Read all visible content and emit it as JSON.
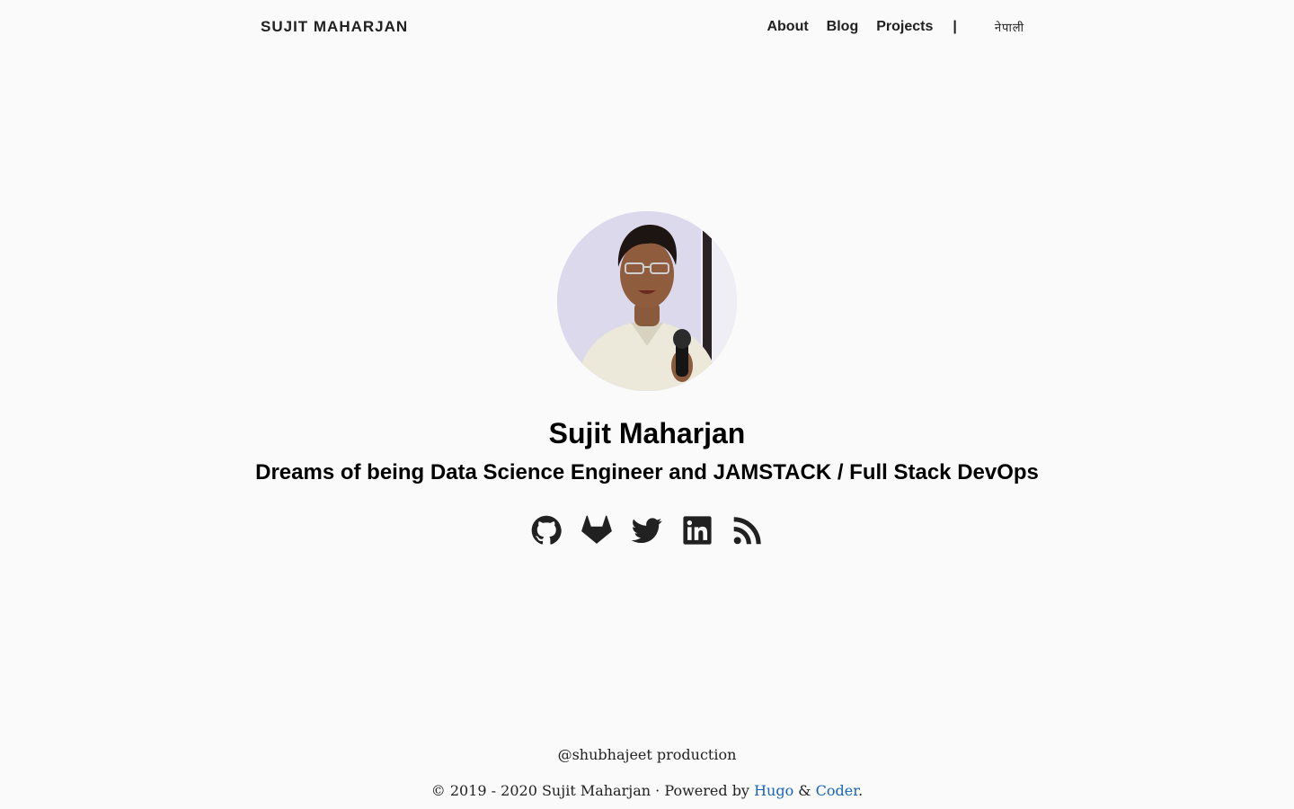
{
  "nav": {
    "brand": "SUJIT MAHARJAN",
    "links": [
      {
        "label": "About"
      },
      {
        "label": "Blog"
      },
      {
        "label": "Projects"
      }
    ],
    "separator": "|",
    "language_label": "नेपाली"
  },
  "hero": {
    "avatar_icon": "profile-photo",
    "name": "Sujit Maharjan",
    "tagline": "Dreams of being Data Science Engineer and JAMSTACK / Full Stack DevOps",
    "social_icons": [
      "github-icon",
      "gitlab-icon",
      "twitter-icon",
      "linkedin-icon",
      "rss-icon"
    ]
  },
  "footer": {
    "credit": "@shubhajeet production",
    "copyright": "© 2019 - 2020 Sujit Maharjan",
    "dot": "·",
    "powered_by": "Powered by",
    "hugo": "Hugo",
    "amp": "&",
    "coder": "Coder",
    "period": "."
  },
  "colors": {
    "background": "#fafafa",
    "text": "#212121",
    "link": "#1565c0"
  }
}
